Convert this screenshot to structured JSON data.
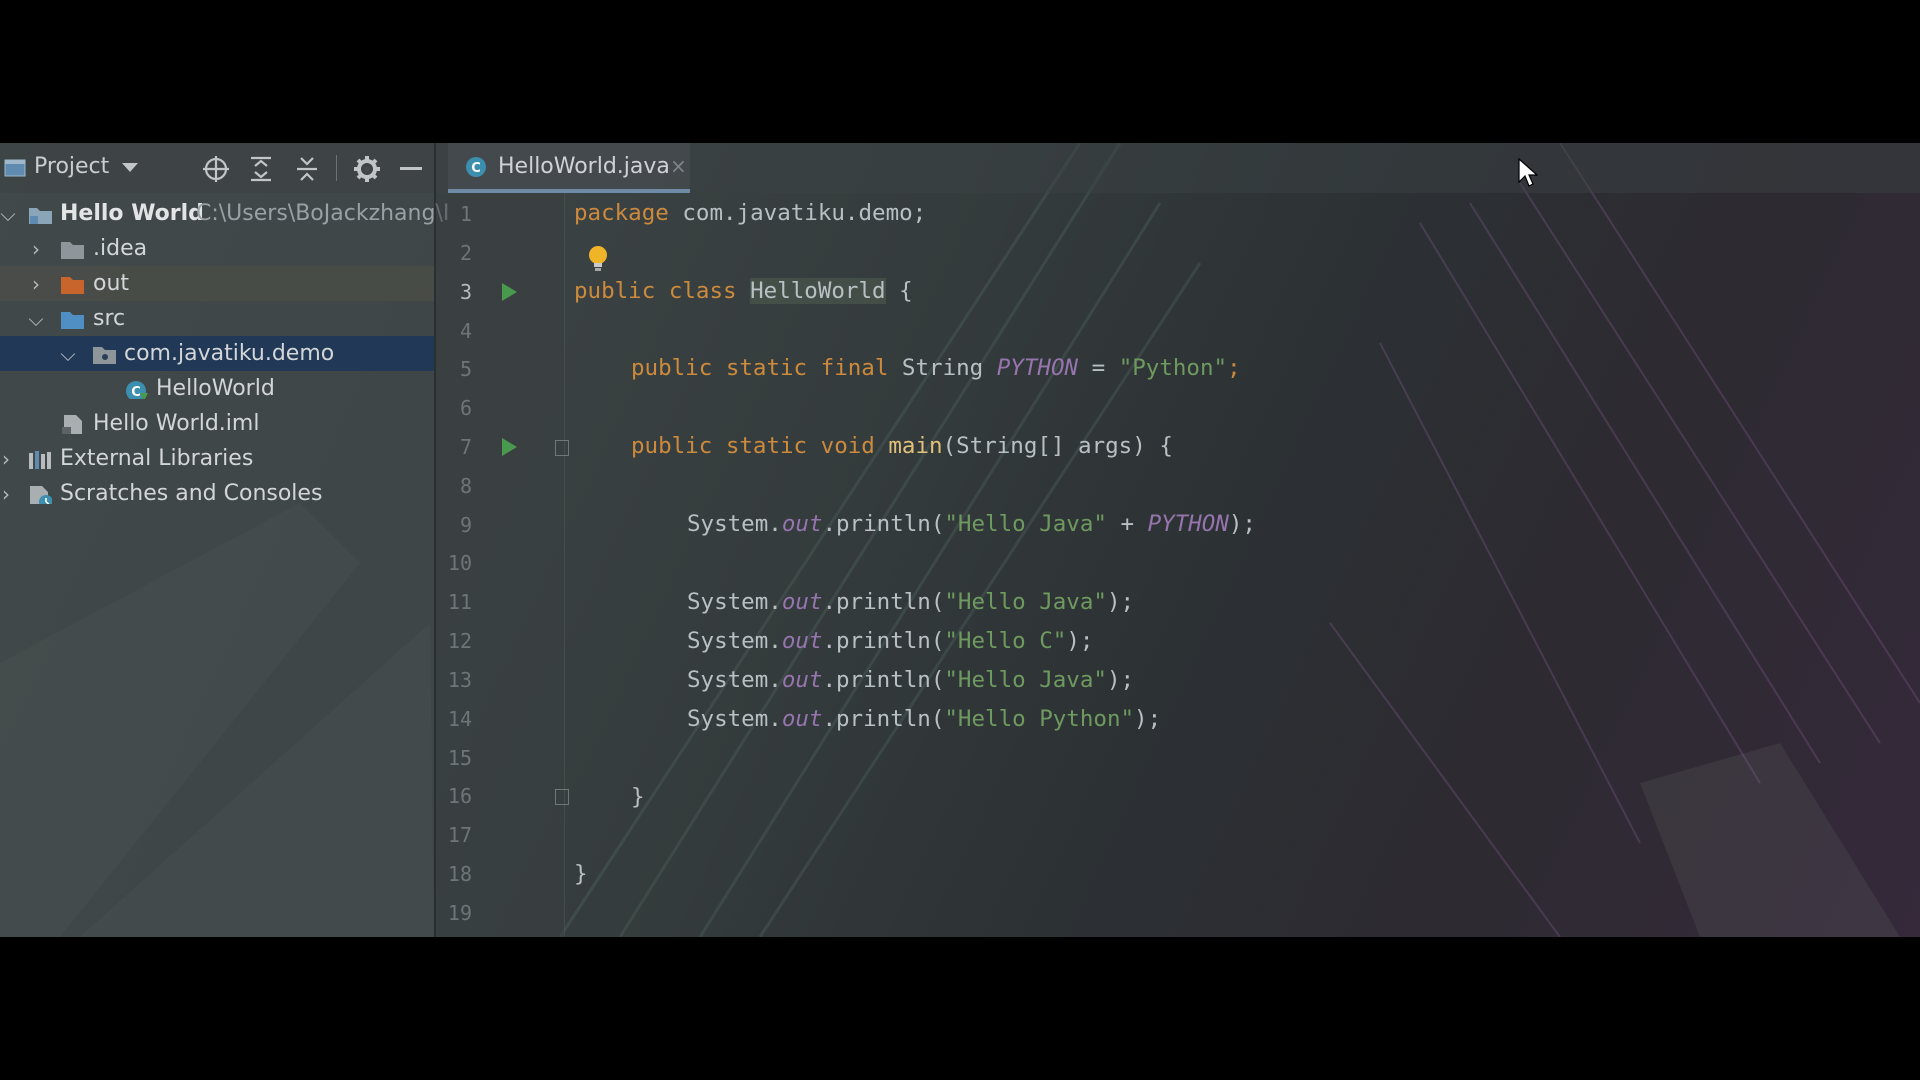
{
  "project_panel": {
    "title": "Project",
    "icons": [
      "project-icon",
      "chevron-down-icon",
      "locate-icon",
      "expand-all-icon",
      "collapse-all-icon",
      "gear-icon",
      "minimize-icon"
    ],
    "tree": [
      {
        "label": "Hello World",
        "path": "C:\\Users\\BoJackzhang\\I",
        "expanded": true,
        "icon": "module-folder-icon"
      },
      {
        "label": ".idea",
        "expanded": false,
        "icon": "folder-icon"
      },
      {
        "label": "out",
        "expanded": false,
        "icon": "excluded-folder-icon"
      },
      {
        "label": "src",
        "expanded": true,
        "icon": "source-folder-icon"
      },
      {
        "label": "com.javatiku.demo",
        "expanded": true,
        "icon": "package-icon",
        "selected": true
      },
      {
        "label": "HelloWorld",
        "icon": "java-class-icon"
      },
      {
        "label": "Hello World.iml",
        "icon": "iml-file-icon"
      },
      {
        "label": "External Libraries",
        "expanded": false,
        "icon": "libraries-icon"
      },
      {
        "label": "Scratches and Consoles",
        "expanded": false,
        "icon": "scratches-icon"
      }
    ]
  },
  "editor": {
    "tab": {
      "label": "HelloWorld.java",
      "close": "×"
    },
    "line_numbers": [
      "1",
      "2",
      "3",
      "4",
      "5",
      "6",
      "7",
      "8",
      "9",
      "10",
      "11",
      "12",
      "13",
      "14",
      "15",
      "16",
      "17",
      "18",
      "19"
    ],
    "current_line": "3",
    "code": {
      "l1": {
        "kw": "package",
        "rest": " com.javatiku.demo;"
      },
      "l3": {
        "kw": "public class",
        "name": "HelloWorld",
        "rest": " {"
      },
      "l5": {
        "kw": "public static final",
        "type": " String ",
        "const": "PYTHON",
        "op": " = ",
        "str": "\"Python\"",
        "end": ";"
      },
      "l7": {
        "kw": "public static void",
        "fn": "main",
        "rest": "(String[] args) {"
      },
      "l9": {
        "pre": "System.",
        "out": "out",
        "mid": ".println(",
        "str": "\"Hello Java\"",
        "plus": " + ",
        "const": "PYTHON",
        "end": ");"
      },
      "l11": {
        "pre": "System.",
        "out": "out",
        "mid": ".println(",
        "str": "\"Hello Java\"",
        "end": ");"
      },
      "l12": {
        "pre": "System.",
        "out": "out",
        "mid": ".println(",
        "str": "\"Hello C\"",
        "end": ");"
      },
      "l13": {
        "pre": "System.",
        "out": "out",
        "mid": ".println(",
        "str": "\"Hello Java\"",
        "end": ");"
      },
      "l14": {
        "pre": "System.",
        "out": "out",
        "mid": ".println(",
        "str": "\"Hello Python\"",
        "end": ");"
      },
      "l16": {
        "text": "}"
      },
      "l18": {
        "text": "}"
      }
    }
  },
  "colors": {
    "keyword": "#cc8a3c",
    "string": "#6f9a5f",
    "constant": "#9674ad",
    "selection": "#1e3858",
    "run": "#4a9a4e"
  }
}
